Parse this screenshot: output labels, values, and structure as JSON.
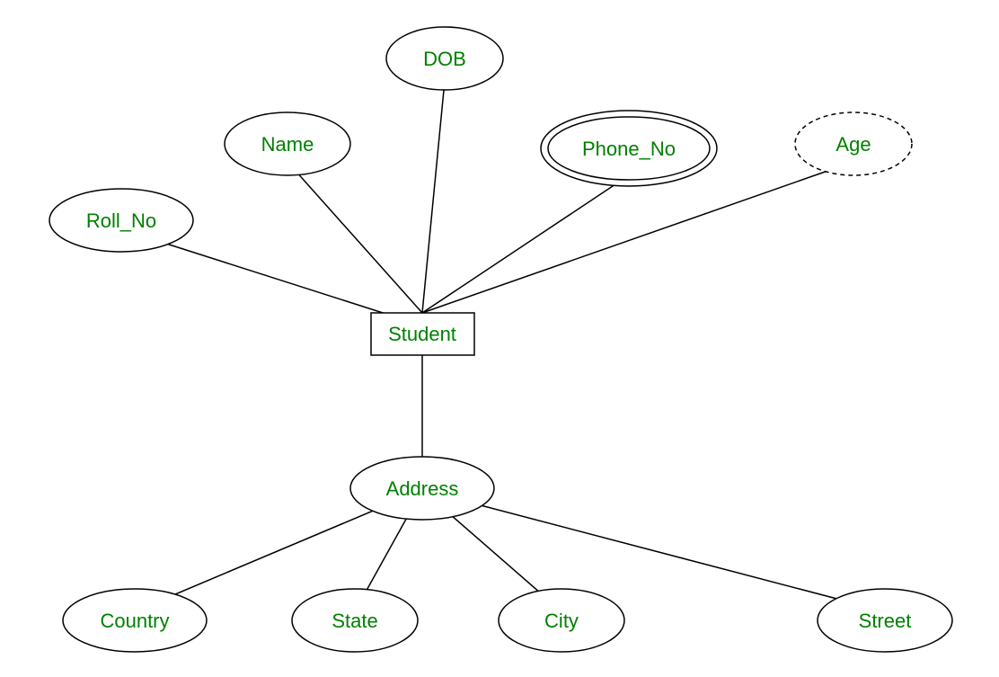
{
  "entity": {
    "label": "Student"
  },
  "attributes": {
    "roll_no": {
      "label": "Roll_No"
    },
    "name": {
      "label": "Name"
    },
    "dob": {
      "label": "DOB"
    },
    "phone_no": {
      "label": "Phone_No"
    },
    "age": {
      "label": "Age"
    },
    "address": {
      "label": "Address"
    },
    "country": {
      "label": "Country"
    },
    "state": {
      "label": "State"
    },
    "city": {
      "label": "City"
    },
    "street": {
      "label": "Street"
    }
  }
}
